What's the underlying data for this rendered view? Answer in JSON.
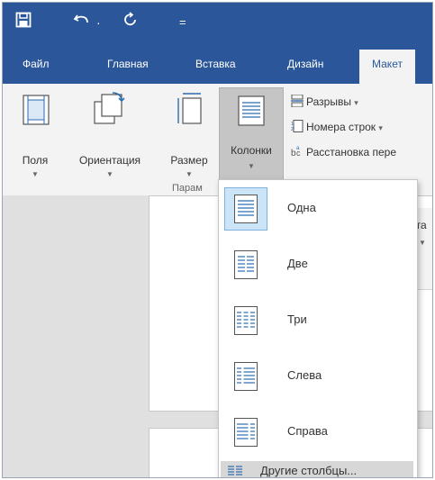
{
  "quick_access": {
    "save_icon": "save-icon",
    "undo_icon": "undo-icon",
    "undo_dropdown": "·",
    "redo_icon": "redo-icon",
    "customize_icon": "customize-icon",
    "customize_glyph": "="
  },
  "tabs": [
    {
      "label": "Файл"
    },
    {
      "label": "Главная"
    },
    {
      "label": "Вставка"
    },
    {
      "label": "Дизайн"
    },
    {
      "label": "Макет",
      "active": true
    }
  ],
  "ribbon": {
    "buttons": [
      {
        "label": "Поля",
        "icon": "margins-icon"
      },
      {
        "label": "Ориентация",
        "icon": "orientation-icon"
      },
      {
        "label": "Размер",
        "icon": "size-icon"
      },
      {
        "label": "Колонки",
        "icon": "columns-icon",
        "pressed": true
      }
    ],
    "small_commands": [
      {
        "label": "Разрывы",
        "icon": "breaks-icon",
        "dropdown": "▾"
      },
      {
        "label": "Номера строк",
        "icon": "line-numbers-icon",
        "dropdown": "▾"
      },
      {
        "label": "Расстановка пере",
        "icon": "hyphenation-icon"
      }
    ],
    "group_label": "Парам"
  },
  "background_text": "нта",
  "columns_menu": {
    "items": [
      {
        "label": "Одна",
        "icon": "one-column-icon",
        "selected": true
      },
      {
        "label": "Две",
        "icon": "two-columns-icon"
      },
      {
        "label": "Три",
        "icon": "three-columns-icon"
      },
      {
        "label": "Слева",
        "icon": "left-column-icon"
      },
      {
        "label": "Справа",
        "icon": "right-column-icon"
      }
    ],
    "more_label": "Другие столбцы...",
    "more_icon": "more-columns-icon"
  },
  "colors": {
    "title_bar": "#2b579a",
    "ribbon": "#f3f3f3",
    "selected_item": "#cce4f7"
  }
}
